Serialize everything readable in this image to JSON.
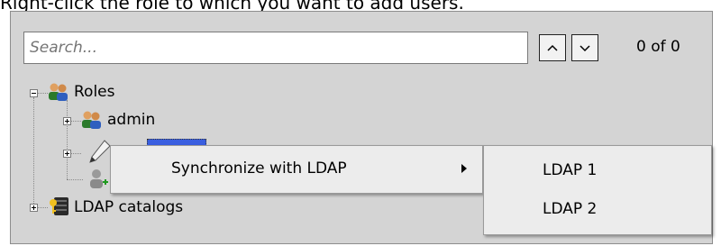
{
  "instruction": "Right-click the role to which you want to add users.",
  "search": {
    "placeholder": "Search...",
    "value": ""
  },
  "nav": {
    "prev_icon": "chevron-up-icon",
    "next_icon": "chevron-down-icon"
  },
  "match_count": "0 of 0",
  "tree": {
    "root_label": "Roles",
    "children": [
      {
        "label": "admin"
      }
    ],
    "ldap_label": "LDAP catalogs"
  },
  "context_menu": {
    "items": [
      {
        "label": "Synchronize with LDAP",
        "has_submenu": true
      }
    ]
  },
  "submenu": {
    "items": [
      {
        "label": "LDAP 1"
      },
      {
        "label": "LDAP 2"
      }
    ]
  },
  "colors": {
    "selection": "#3a5fe0",
    "panel_bg": "#d4d4d4",
    "menu_bg": "#ececec"
  }
}
